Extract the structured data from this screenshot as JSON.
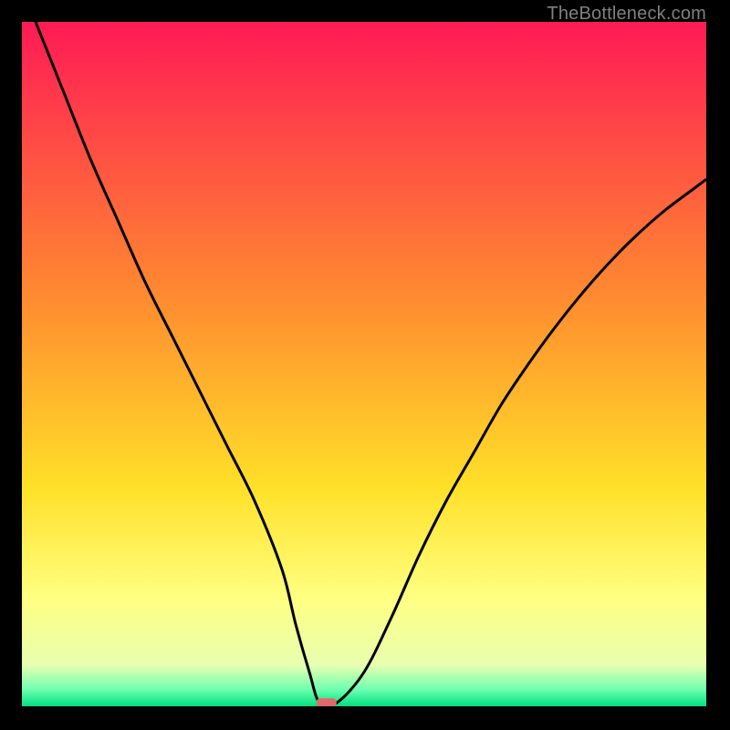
{
  "attribution": "TheBottleneck.com",
  "chart_data": {
    "type": "line",
    "title": "",
    "xlabel": "",
    "ylabel": "",
    "xlim": [
      0,
      100
    ],
    "ylim": [
      0,
      100
    ],
    "grid": false,
    "legend": false,
    "background_gradient": {
      "stops": [
        {
          "pct": 0,
          "color": "#ff1a55"
        },
        {
          "pct": 40,
          "color": "#ff8a30"
        },
        {
          "pct": 68,
          "color": "#ffe028"
        },
        {
          "pct": 84,
          "color": "#ffff80"
        },
        {
          "pct": 94,
          "color": "#e8ffb0"
        },
        {
          "pct": 97.5,
          "color": "#70ffb0"
        },
        {
          "pct": 100,
          "color": "#00e080"
        }
      ]
    },
    "series": [
      {
        "name": "bottleneck-curve",
        "color": "#000000",
        "x": [
          2,
          6,
          10,
          14,
          18,
          22,
          26,
          30,
          34,
          38,
          40,
          42,
          43.5,
          46,
          50,
          54,
          58,
          62,
          66,
          70,
          74,
          78,
          82,
          86,
          90,
          94,
          98,
          100
        ],
        "y": [
          100,
          90,
          80,
          71,
          62,
          54,
          46,
          38,
          30,
          20,
          12,
          5,
          0.5,
          0.5,
          5,
          13,
          22,
          30,
          37,
          44,
          50,
          55.5,
          60.5,
          65,
          69,
          72.5,
          75.5,
          77
        ]
      }
    ],
    "marker": {
      "x": 44.5,
      "y": 0.5,
      "color": "#e06a6a",
      "label": "optimal-point"
    }
  }
}
